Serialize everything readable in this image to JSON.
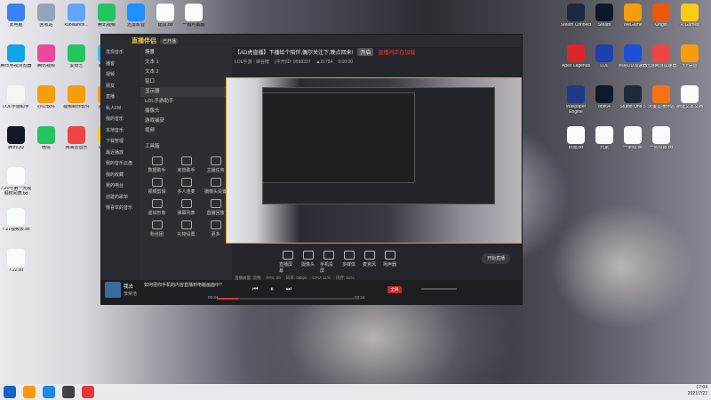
{
  "desktop": {
    "left_icons": [
      {
        "label": "此电脑",
        "color": "#3b82f6"
      },
      {
        "label": "回收站",
        "color": "#94a3b8"
      },
      {
        "label": "koolaunch...",
        "color": "#60a5fa"
      },
      {
        "label": "腾讯视频",
        "color": "#22c55e"
      },
      {
        "label": "迅雷影音",
        "color": "#1e90ff"
      },
      {
        "label": "建议.txt",
        "color": "#f8fafc"
      },
      {
        "label": "一键可截图",
        "color": "#f8fafc"
      },
      {
        "label": "腾讯电视浏览器",
        "color": "#0ea5e9"
      },
      {
        "label": "腾讯视频",
        "color": "#ec4899"
      },
      {
        "label": "爱奇艺",
        "color": "#22c55e"
      },
      {
        "label": "腾讯QQ",
        "color": "#38bdf8"
      },
      {
        "label": "LOL手游助手",
        "color": "#f5f5f5"
      },
      {
        "label": "办公软件",
        "color": "#f59e0b"
      },
      {
        "label": "视频制作软件",
        "color": "#f59e0b"
      },
      {
        "label": "主机软件",
        "color": "#f59e0b"
      },
      {
        "label": "腾讯QQ",
        "color": "#111827"
      },
      {
        "label": "微信",
        "color": "#22c55e"
      },
      {
        "label": "网易云音乐",
        "color": "#ef4444"
      },
      {
        "label": "QQ音乐",
        "color": "#facc15"
      },
      {
        "label": "7.20号第一天视频时间表.txt",
        "color": "#f8fafc"
      },
      {
        "label": "7.21视频表.txt",
        "color": "#f8fafc"
      },
      {
        "label": "7.22.txt",
        "color": "#f8fafc"
      }
    ],
    "right_icons": [
      {
        "label": "Steam Connect",
        "color": "#1e293b"
      },
      {
        "label": "Steam",
        "color": "#0f172a"
      },
      {
        "label": "WeGame",
        "color": "#f59e0b"
      },
      {
        "label": "Origin",
        "color": "#ea580c"
      },
      {
        "label": "R Games",
        "color": "#facc15"
      },
      {
        "label": "Apex Legends",
        "color": "#dc2626"
      },
      {
        "label": "LOL",
        "color": "#1e40af"
      },
      {
        "label": "网易UU加速器",
        "color": "#1d4ed8"
      },
      {
        "label": "迅游网游加速器",
        "color": "#ef4444"
      },
      {
        "label": "YY语音",
        "color": "#f59e0b"
      },
      {
        "label": "Wallpaper Engine",
        "color": "#1e3a8a"
      },
      {
        "label": "obs64",
        "color": "#111827"
      },
      {
        "label": "Studio One 5",
        "color": "#1e293b"
      },
      {
        "label": "火萤直播伴侣",
        "color": "#f97316"
      },
      {
        "label": "新建文本文档",
        "color": "#f8fafc"
      },
      {
        "label": "标题.txt",
        "color": "#f8fafc"
      },
      {
        "label": "元素",
        "color": "#f8fafc"
      },
      {
        "label": "一条线.txt",
        "color": "#f8fafc"
      },
      {
        "label": "一些项目.txt",
        "color": "#f8fafc"
      }
    ]
  },
  "app": {
    "name": "直播伴侣",
    "status_chip": "已开播",
    "notice": "【AD虎直播】下播给个陪伴,偶尔关注下,晚点回来!",
    "notice_button": "开启",
    "notice_red": "直播间正在加载",
    "stats": [
      "LOL手游 - 峡谷榜",
      "(中开)ID: 9558337",
      "▲21784",
      "0:00:00"
    ],
    "scenes_tab": "场景",
    "scene_items": [
      "文本 1",
      "文本 2",
      "窗口",
      "显示器",
      "LOL手游助手",
      "摄像头",
      "游戏捕获",
      "视频"
    ],
    "tools_title": "工具箱",
    "tools": [
      "数据助手",
      "房管助手",
      "主播任务",
      "视频剪辑",
      "多人连麦",
      "摄像头设置",
      "虚拟形象",
      "弹幕列表",
      "直播回放",
      "粉丝团",
      "礼物设置",
      "更多"
    ],
    "controls": [
      "直播屏幕",
      "摄像头",
      "手机投屏",
      "多媒体",
      "麦克风",
      "扬声器"
    ],
    "start_live": "开始直播",
    "statusbar": [
      "直播质量: 流畅",
      "FPS: 60",
      "码率: 0kbps",
      "CPU: 11%",
      "内存: 52%"
    ],
    "end_button": "全屏"
  },
  "music": {
    "sidebar": [
      "发现音乐",
      "播客",
      "视频",
      "朋友",
      "直播",
      "私人FM",
      "我的音乐",
      "本地音乐",
      "下载管理",
      "最近播放",
      "我的音乐云盘",
      "我的收藏",
      "我的电台",
      "创建的歌单",
      "我喜欢的音乐"
    ],
    "song_title": "我去",
    "artist": "李荣浩",
    "lyric": "如何把你手机的内容直播到电脑画面中?",
    "time_current": "00:34",
    "time_total": "03:34",
    "progress": 0.15
  },
  "taskbar": {
    "time": "17:04",
    "date": "2021/7/22"
  }
}
